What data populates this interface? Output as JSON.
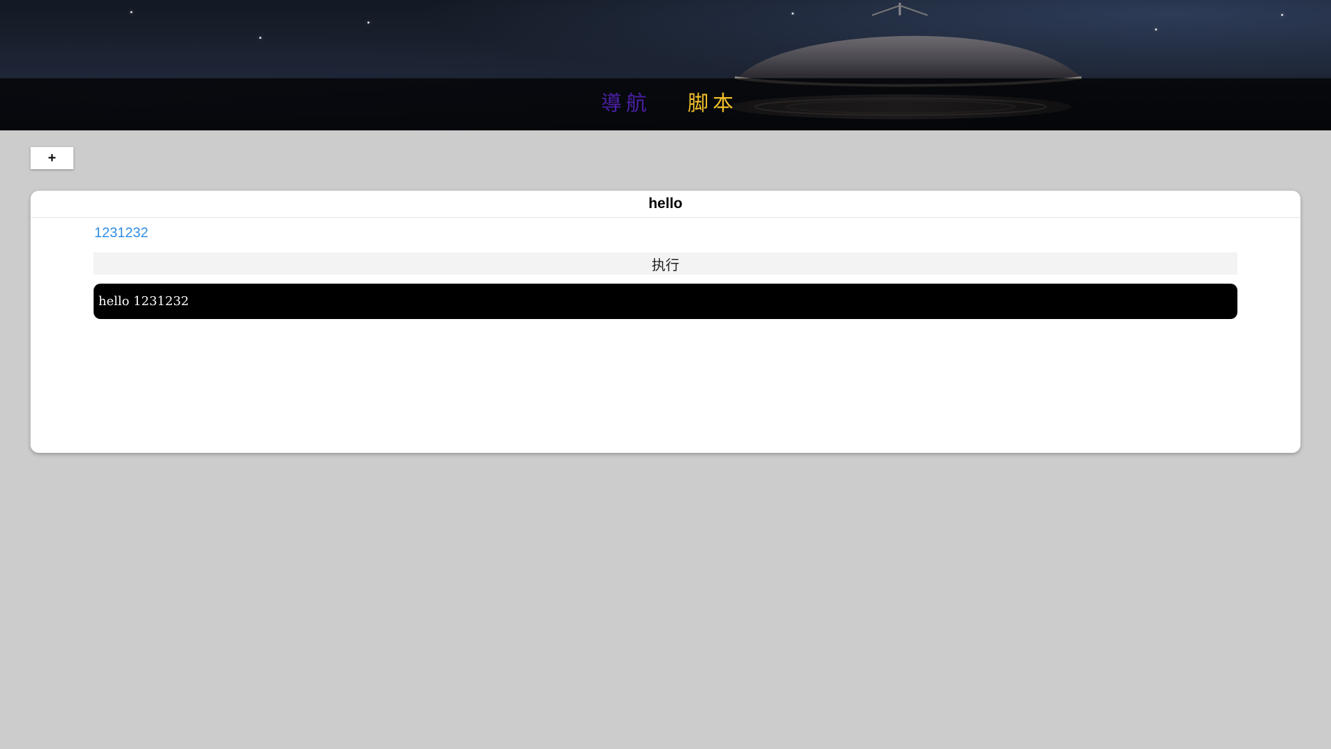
{
  "header": {
    "nav_items": [
      {
        "label": "導航",
        "color": "#4b1fa6"
      },
      {
        "label": "脚本",
        "color": "#f2bf2a"
      }
    ]
  },
  "toolbar": {
    "add_label": "+"
  },
  "script_card": {
    "title": "hello",
    "script_name": "1231232",
    "execute_label": "执行",
    "output": "hello 1231232"
  },
  "colors": {
    "page_background": "#cccccc",
    "link": "#2f8de4",
    "terminal_background": "#000000"
  }
}
